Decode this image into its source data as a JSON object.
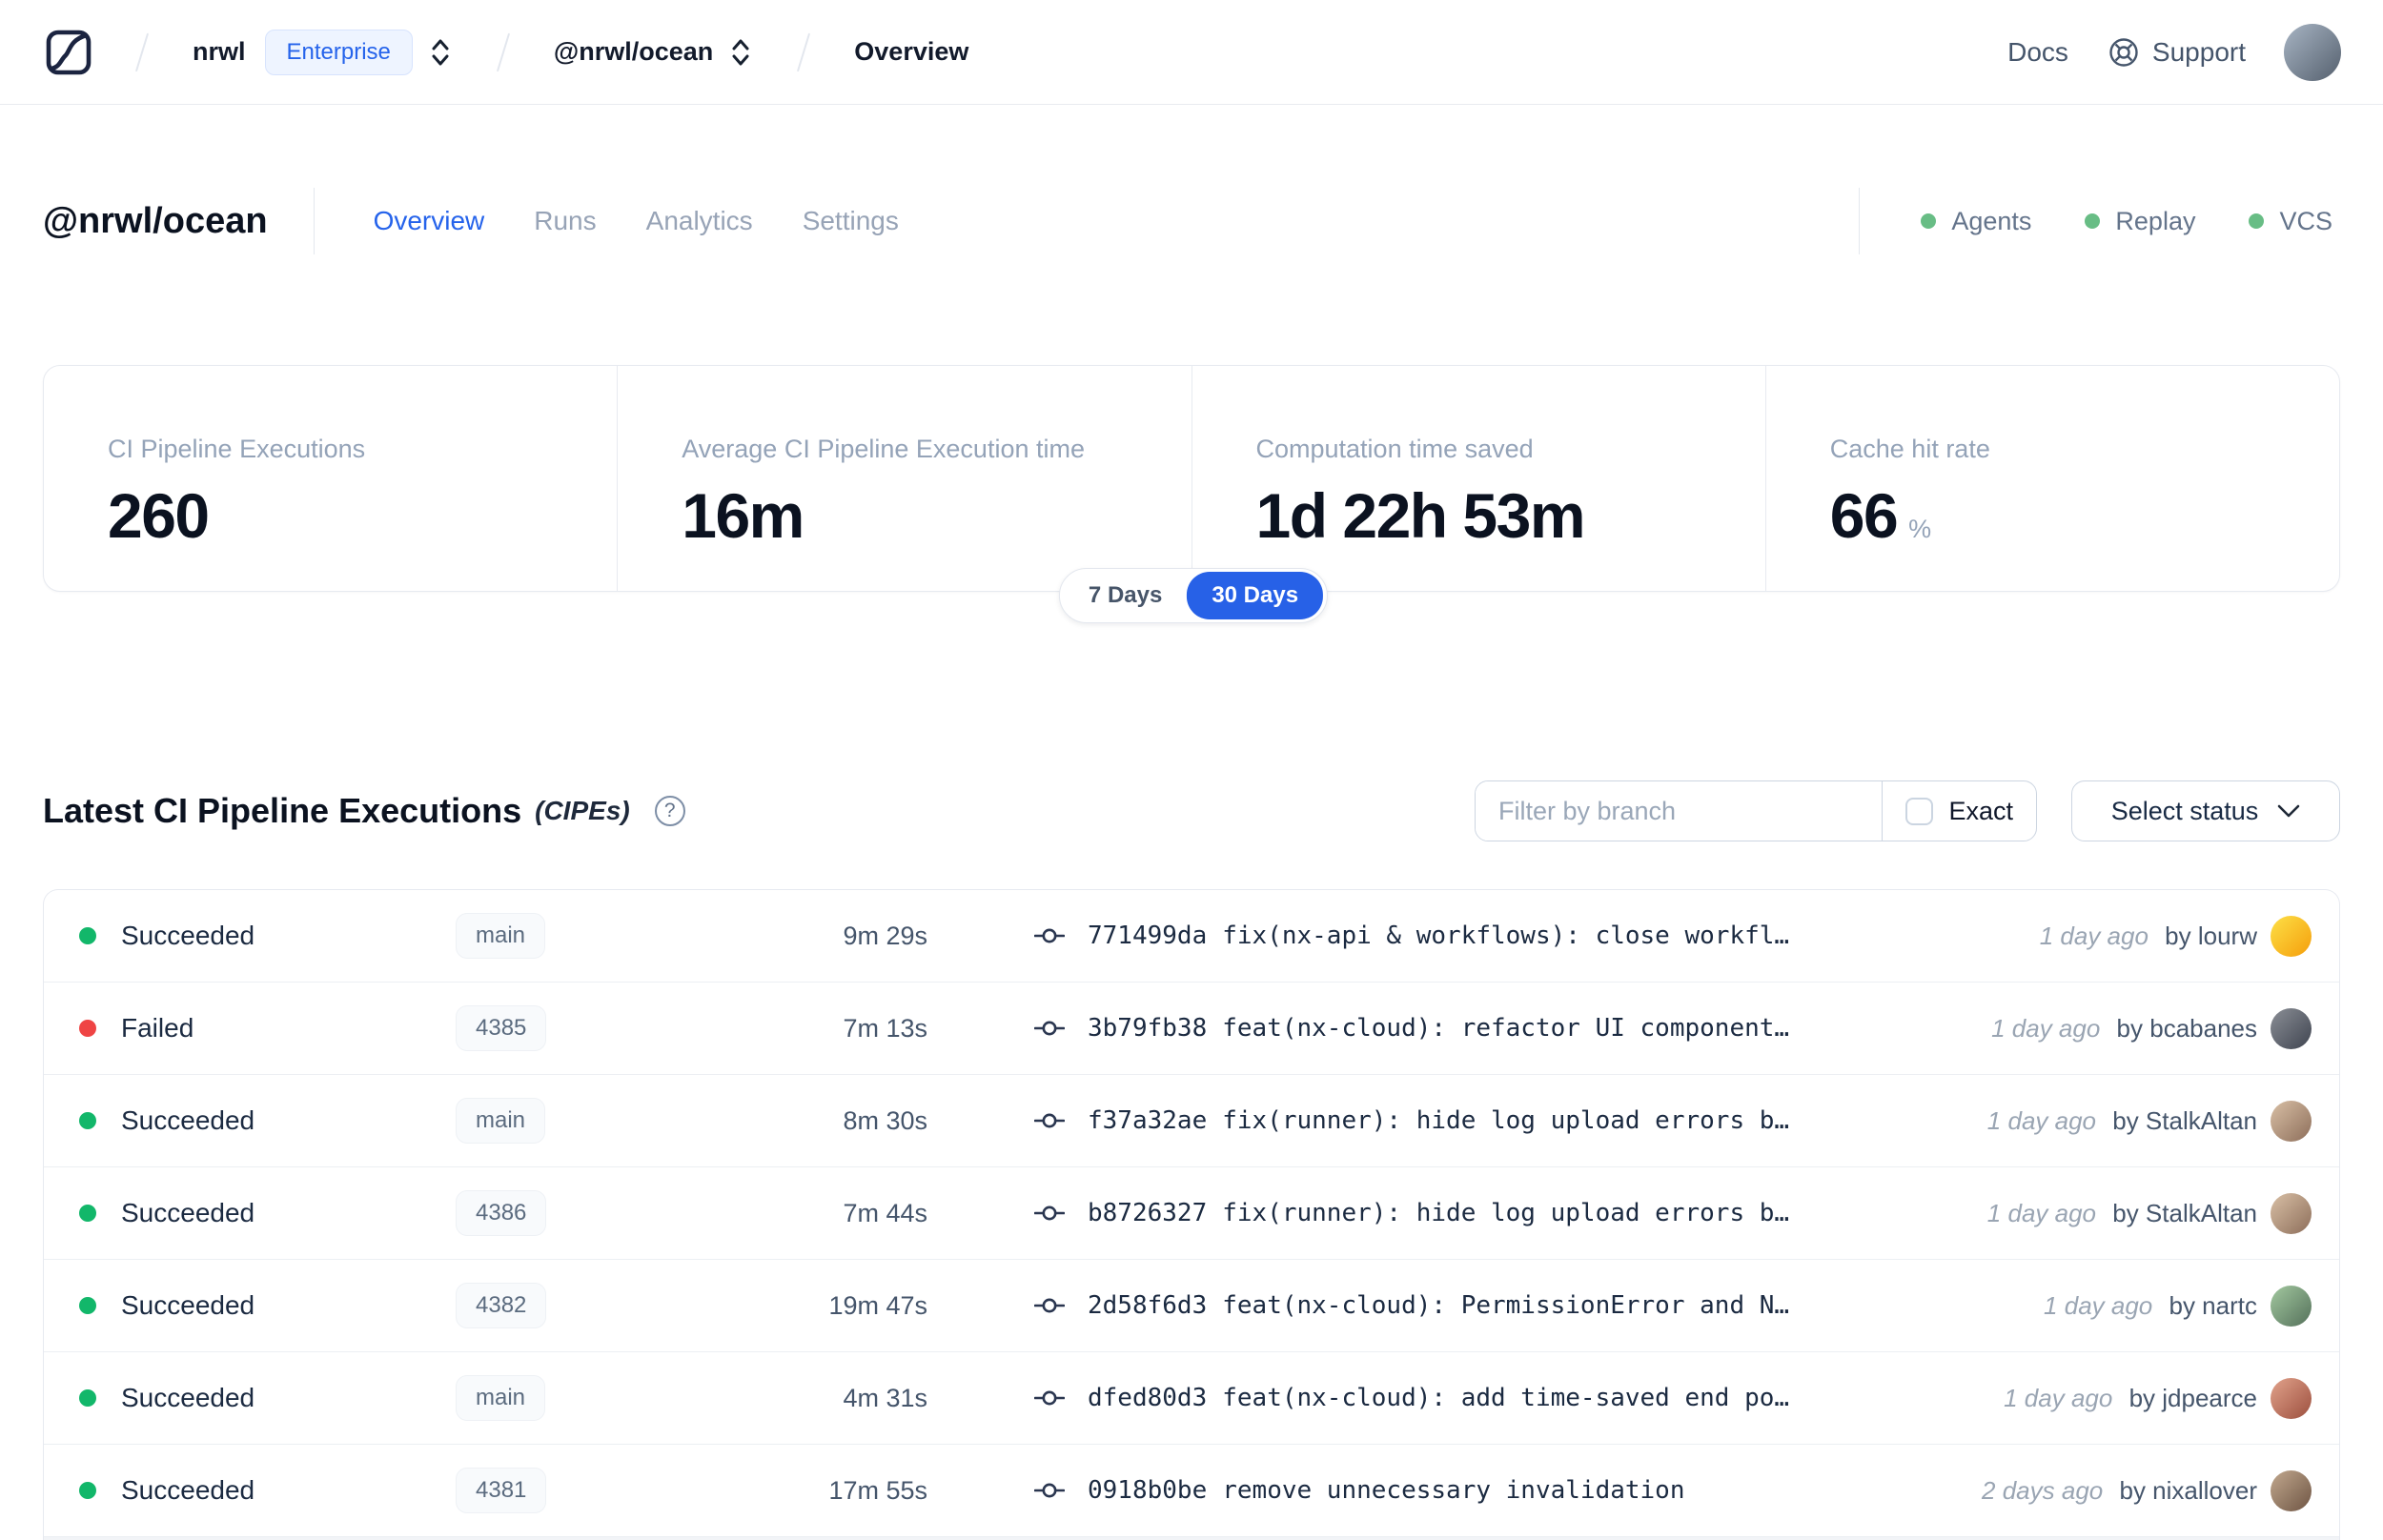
{
  "colors": {
    "accent_blue": "#2563eb",
    "success_green": "#12b76a",
    "failed_red": "#ef4444",
    "indicator_green": "#68bd85"
  },
  "topbar": {
    "breadcrumb": {
      "org": "nrwl",
      "org_badge": "Enterprise",
      "workspace": "@nrwl/ocean",
      "page": "Overview"
    },
    "docs_label": "Docs",
    "support_label": "Support",
    "avatar": {
      "from": "#a8b5c4",
      "to": "#55606e"
    }
  },
  "page_header": {
    "title": "@nrwl/ocean",
    "tabs": [
      {
        "label": "Overview",
        "active": true
      },
      {
        "label": "Runs",
        "active": false
      },
      {
        "label": "Analytics",
        "active": false
      },
      {
        "label": "Settings",
        "active": false
      }
    ],
    "status_indicators": [
      {
        "label": "Agents",
        "color": "#68bd85"
      },
      {
        "label": "Replay",
        "color": "#68bd85"
      },
      {
        "label": "VCS",
        "color": "#68bd85"
      }
    ]
  },
  "stats": {
    "cards": [
      {
        "label": "CI Pipeline Executions",
        "value": "260",
        "unit": ""
      },
      {
        "label": "Average CI Pipeline Execution time",
        "value": "16m",
        "unit": ""
      },
      {
        "label": "Computation time saved",
        "value": "1d 22h 53m",
        "unit": ""
      },
      {
        "label": "Cache hit rate",
        "value": "66",
        "unit": "%"
      }
    ],
    "range_toggle": {
      "options": [
        "7 Days",
        "30 Days"
      ],
      "selected": "30 Days"
    }
  },
  "cipe_section": {
    "title": "Latest CI Pipeline Executions",
    "title_suffix": "(CIPEs)",
    "help_icon": "?",
    "filter": {
      "placeholder": "Filter by branch",
      "exact_label": "Exact",
      "exact_checked": false
    },
    "status_select_label": "Select status"
  },
  "table": {
    "rows": [
      {
        "status": "Succeeded",
        "status_color": "#12b76a",
        "branch": "main",
        "duration": "9m 29s",
        "commit_hash": "771499da",
        "commit_message": "fix(nx-api & workflows): close workfl…",
        "time_ago": "1 day ago",
        "author": "by lourw",
        "avatar_from": "#fde047",
        "avatar_to": "#f59e0b"
      },
      {
        "status": "Failed",
        "status_color": "#ef4444",
        "branch": "4385",
        "duration": "7m 13s",
        "commit_hash": "3b79fb38",
        "commit_message": "feat(nx-cloud): refactor UI component…",
        "time_ago": "1 day ago",
        "author": "by bcabanes",
        "avatar_from": "#8b8f96",
        "avatar_to": "#3f4450"
      },
      {
        "status": "Succeeded",
        "status_color": "#12b76a",
        "branch": "main",
        "duration": "8m 30s",
        "commit_hash": "f37a32ae",
        "commit_message": "fix(runner): hide log upload errors b…",
        "time_ago": "1 day ago",
        "author": "by StalkAltan",
        "avatar_from": "#d9c0a6",
        "avatar_to": "#8d6e5a"
      },
      {
        "status": "Succeeded",
        "status_color": "#12b76a",
        "branch": "4386",
        "duration": "7m 44s",
        "commit_hash": "b8726327",
        "commit_message": "fix(runner): hide log upload errors b…",
        "time_ago": "1 day ago",
        "author": "by StalkAltan",
        "avatar_from": "#d9c0a6",
        "avatar_to": "#8d6e5a"
      },
      {
        "status": "Succeeded",
        "status_color": "#12b76a",
        "branch": "4382",
        "duration": "19m 47s",
        "commit_hash": "2d58f6d3",
        "commit_message": "feat(nx-cloud): PermissionError and N…",
        "time_ago": "1 day ago",
        "author": "by nartc",
        "avatar_from": "#a3c9a0",
        "avatar_to": "#54705a"
      },
      {
        "status": "Succeeded",
        "status_color": "#12b76a",
        "branch": "main",
        "duration": "4m 31s",
        "commit_hash": "dfed80d3",
        "commit_message": "feat(nx-cloud): add time-saved end po…",
        "time_ago": "1 day ago",
        "author": "by jdpearce",
        "avatar_from": "#e2a38c",
        "avatar_to": "#9c4f3e"
      },
      {
        "status": "Succeeded",
        "status_color": "#12b76a",
        "branch": "4381",
        "duration": "17m 55s",
        "commit_hash": "0918b0be",
        "commit_message": "remove unnecessary invalidation",
        "time_ago": "2 days ago",
        "author": "by nixallover",
        "avatar_from": "#c2a98f",
        "avatar_to": "#6e5443"
      }
    ]
  }
}
